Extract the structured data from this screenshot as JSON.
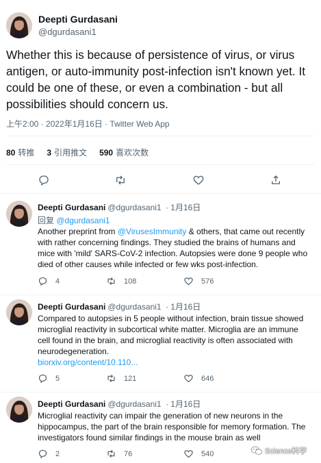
{
  "main_tweet": {
    "author_name": "Deepti Gurdasani",
    "author_handle": "@dgurdasani1",
    "text": "Whether this is because of persistence of virus, or virus antigen, or auto-immunity post-infection isn't known yet. It could be one of these, or even a combination - but all possibilities should concern us.",
    "timestamp": "上午2:00 · 2022年1月16日 · Twitter Web App",
    "stats": {
      "retweets_count": "80",
      "retweets_label": "转推",
      "quotes_count": "3",
      "quotes_label": "引用推文",
      "likes_count": "590",
      "likes_label": "喜欢次数"
    },
    "actions": [
      "reply-icon",
      "retweet-icon",
      "like-icon",
      "share-icon"
    ]
  },
  "replies": [
    {
      "author_name": "Deepti Gurdasani",
      "author_handle": "@dgurdasani1",
      "date": "· 1月16日",
      "reply_to_prefix": "回复",
      "reply_to_handle": "@dgurdasani1",
      "text_before_mention": "Another preprint from ",
      "mention": "@VirusesImmunity",
      "text_line1_after": " & others, that came out recently",
      "text_rest": [
        "with rather concerning findings. They studied the brains of humans and",
        "mice with 'mild' SARS-CoV-2 infection. Autopsies were done 9 people who",
        "died of other causes while infected or few wks post-infection."
      ],
      "reply_count": "4",
      "retweet_count": "108",
      "like_count": "576"
    },
    {
      "author_name": "Deepti Gurdasani",
      "author_handle": "@dgurdasani1",
      "date": "· 1月16日",
      "text_lines": [
        "Compared to autopsies in 5 people without infection, brain tissue showed",
        "microglial reactivity in subcortical white matter. Microglia are an immune",
        "cell found in the brain, and microglial reactivity is often associated with",
        "neurodegeneration."
      ],
      "link": "biorxiv.org/content/10.110...",
      "reply_count": "5",
      "retweet_count": "121",
      "like_count": "646"
    },
    {
      "author_name": "Deepti Gurdasani",
      "author_handle": "@dgurdasani1",
      "date": "· 1月16日",
      "text_lines": [
        "Microglial reactivity can impair the generation of new neurons in the",
        "hippocampus, the part of the brain responsible for memory formation. The",
        "investigators found similar findings in the mouse brain as well"
      ],
      "reply_count": "2",
      "retweet_count": "76",
      "like_count": "540"
    }
  ],
  "watermark": {
    "text": "Science科学",
    "icon": "wechat-icon"
  },
  "colors": {
    "text": "#0f1419",
    "secondary": "#536471",
    "link": "#1d9bf0",
    "divider": "#eff3f4"
  }
}
